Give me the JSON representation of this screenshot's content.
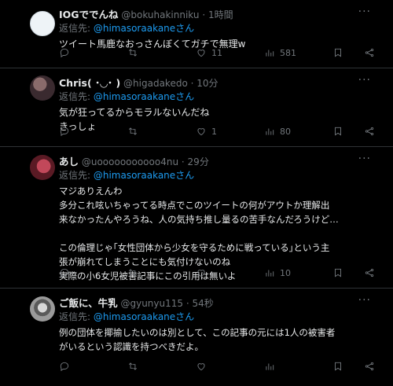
{
  "replies": [
    {
      "name": "IOGででんね",
      "handle": "@bokuhakinniku",
      "time": "1時間",
      "reply_prefix": "返信先: ",
      "reply_to": "@himasoraakaneさん",
      "text": "ツイート馬鹿なおっさんぼくてガチで無理w",
      "likes": "11",
      "views": "581"
    },
    {
      "name": "Chris( ･◡･ )",
      "handle": "@higadakedo",
      "time": "10分",
      "reply_prefix": "返信先: ",
      "reply_to": "@himasoraakaneさん",
      "text": "気が狂ってるからモラルないんだね\nきっしょ",
      "likes": "1",
      "views": "80"
    },
    {
      "name": "あし",
      "handle": "@uooooooooooo4nu",
      "time": "29分",
      "reply_prefix": "返信先: ",
      "reply_to": "@himasoraakaneさん",
      "text": "マジありえんわ\n多分これ呟いちゃってる時点でこのツイートの何がアウトか理解出\n来なかったんやろうね、人の気持ち推し量るの苦手なんだろうけど…\n\nこの倫理じゃ｢女性団体から少女を守るために戦っている｣という主\n張が崩れてしまうことにも気付けないのね\n実際の小6女児被害記事にこの引用は無いよ",
      "likes": "",
      "views": "10"
    },
    {
      "name": "ご飯に、牛乳",
      "handle": "@gyunyu115",
      "time": "54秒",
      "reply_prefix": "返信先: ",
      "reply_to": "@himasoraakaneさん",
      "text": "例の団体を揶揄したいのは別として、この記事の元には1人の被害者\nがいるという認識を持つべきだよ。",
      "likes": "",
      "views": ""
    }
  ],
  "separator": "·",
  "more_label": "···",
  "icons": [
    "reply-icon",
    "retweet-icon",
    "like-icon",
    "views-icon",
    "bookmark-icon",
    "share-icon",
    "more-icon"
  ],
  "colors": {
    "background": "#000000",
    "text": "#e7e9ea",
    "muted": "#71767b",
    "link": "#1d9bf0",
    "divider": "#2f3336"
  }
}
